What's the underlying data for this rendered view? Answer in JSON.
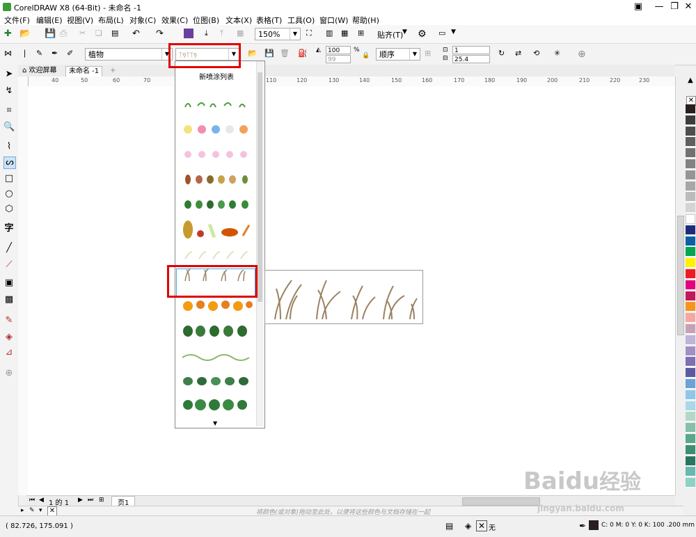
{
  "window": {
    "title": "CorelDRAW X8 (64-Bit) - 未命名 -1"
  },
  "menu": [
    "文件(F)",
    "编辑(E)",
    "视图(V)",
    "布局(L)",
    "对象(C)",
    "效果(C)",
    "位图(B)",
    "文本(X)",
    "表格(T)",
    "工具(O)",
    "窗口(W)",
    "帮助(H)"
  ],
  "toolbar": {
    "zoom": "150%",
    "snap_label": "贴齐(T)"
  },
  "propbar": {
    "category": "植物",
    "size_top": "100",
    "size_bottom": "99",
    "percent": "%",
    "order": "顺序",
    "spacing_count": "1",
    "spacing_dist": "25.4"
  },
  "tabs": {
    "welcome": "欢迎屏幕",
    "doc": "未命名 -1",
    "add": "+"
  },
  "ruler": {
    "h_ticks": [
      "40",
      "50",
      "60",
      "70",
      "110",
      "120",
      "130",
      "140",
      "150",
      "160",
      "170",
      "180",
      "190",
      "200",
      "210",
      "220",
      "230"
    ]
  },
  "dropdown": {
    "header": "新喷涂列表"
  },
  "pagebar": {
    "page_of": "1 的 1",
    "page_tab": "页1"
  },
  "docbar": {
    "hint": "将颜色(或对象)拖动至此处，以便将这些颜色与文档存储在一起"
  },
  "status": {
    "coords": "( 82.726, 175.091 )",
    "fill_none": "无",
    "outline": "C: 0 M: 0 Y: 0 K: 100 .200 mm"
  },
  "palette": {
    "colors": [
      "#2a1f1f",
      "#3c3c3c",
      "#4d4d4d",
      "#5f5f5f",
      "#717171",
      "#838383",
      "#959595",
      "#a7a7a7",
      "#bbbbbb",
      "#d4d4d4",
      "#ffffff",
      "#1e2d7a",
      "#0b5fa8",
      "#00a651",
      "#fff200",
      "#ed1c24",
      "#e4007e",
      "#c2185b",
      "#f7941d",
      "#f4a8a0",
      "#c7a0b8",
      "#bfb3d6",
      "#a28fc6",
      "#7f6fb3",
      "#5b5aa0",
      "#6ba2d8",
      "#8fc7e8",
      "#a8d8ea",
      "#b2d8c8",
      "#86c0a8",
      "#5aa88a",
      "#3d8f72",
      "#2a7560",
      "#67b8b0",
      "#8fd0c8"
    ]
  },
  "watermark": {
    "brand": "Baidu",
    "cn": "经验",
    "url": "jingyan.baidu.com"
  }
}
